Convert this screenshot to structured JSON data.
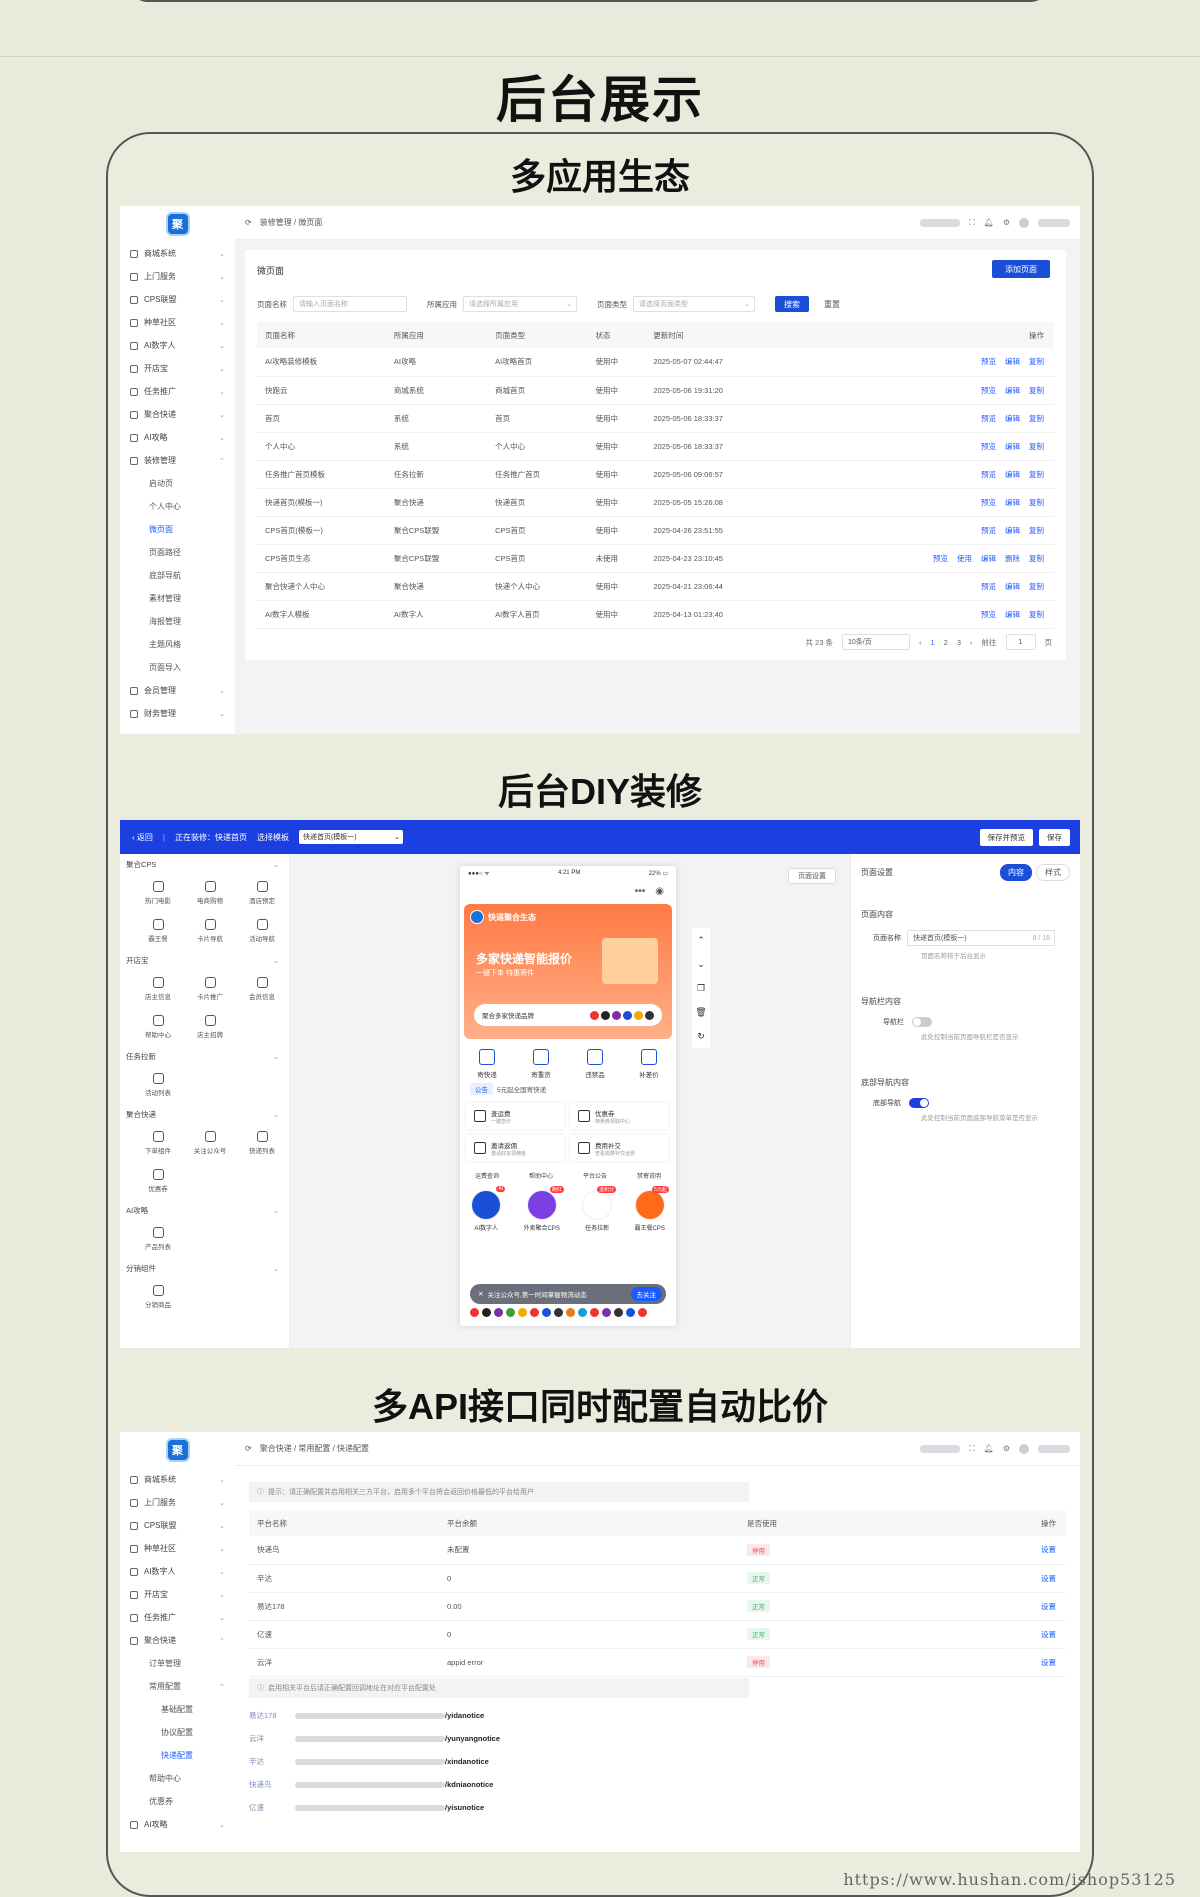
{
  "header_title": "后台展示",
  "sections": {
    "s1": "多应用生态",
    "s2": "后台DIY装修",
    "s3": "多API接口同时配置自动比价"
  },
  "logo_text": "聚",
  "shot1": {
    "breadcrumb": "装修管理 / 微页面",
    "nav": [
      {
        "label": "商城系统",
        "icon": "shop-icon"
      },
      {
        "label": "上门服务",
        "icon": "home-service-icon"
      },
      {
        "label": "CPS联盟",
        "icon": "cps-icon"
      },
      {
        "label": "种草社区",
        "icon": "community-icon"
      },
      {
        "label": "AI数字人",
        "icon": "ai-icon"
      },
      {
        "label": "开店宝",
        "icon": "store-icon"
      },
      {
        "label": "任务推广",
        "icon": "task-icon"
      },
      {
        "label": "聚合快递",
        "icon": "express-icon"
      },
      {
        "label": "AI攻略",
        "icon": "guide-icon"
      },
      {
        "label": "装修管理",
        "icon": "decor-icon"
      }
    ],
    "nav_sub": [
      "启动页",
      "个人中心",
      "微页面",
      "页面路径",
      "底部导航",
      "素材管理",
      "海报管理",
      "主题风格",
      "页面导入"
    ],
    "nav_after": [
      {
        "label": "会员管理",
        "icon": "member-icon"
      },
      {
        "label": "财务管理",
        "icon": "finance-icon"
      }
    ],
    "card_title": "微页面",
    "add_button": "添加页面",
    "filters": {
      "name_label": "页面名称",
      "name_placeholder": "请输入页面名称",
      "app_label": "所属应用",
      "app_placeholder": "请选择所属应用",
      "type_label": "页面类型",
      "type_placeholder": "请选择页面类型",
      "search": "搜索",
      "reset": "重置"
    },
    "columns": [
      "页面名称",
      "所属应用",
      "页面类型",
      "状态",
      "更新时间",
      "操作"
    ],
    "rows": [
      [
        "AI攻略装修模板",
        "AI攻略",
        "AI攻略首页",
        "使用中",
        "2025-05-07 02:44:47"
      ],
      [
        "快跑云",
        "商城系统",
        "商城首页",
        "使用中",
        "2025-05-06 19:31:20"
      ],
      [
        "首页",
        "系统",
        "首页",
        "使用中",
        "2025-05-06 18:33:37"
      ],
      [
        "个人中心",
        "系统",
        "个人中心",
        "使用中",
        "2025-05-06 18:33:37"
      ],
      [
        "任务推广首页模板",
        "任务拉新",
        "任务推广首页",
        "使用中",
        "2025-05-06 09:06:57"
      ],
      [
        "快递首页(模板一)",
        "聚合快递",
        "快递首页",
        "使用中",
        "2025-05-05 15:26:08"
      ],
      [
        "CPS首页(模板一)",
        "聚合CPS联盟",
        "CPS首页",
        "使用中",
        "2025-04-26 23:51:55"
      ],
      [
        "CPS首页生态",
        "聚合CPS联盟",
        "CPS首页",
        "未使用",
        "2025-04-23 23:10:45"
      ],
      [
        "聚合快递个人中心",
        "聚合快递",
        "快递个人中心",
        "使用中",
        "2025-04-21 23:06:44"
      ],
      [
        "AI数字人模板",
        "AI数字人",
        "AI数字人首页",
        "使用中",
        "2025-04-13 01:23:40"
      ]
    ],
    "ops": [
      "预览",
      "编辑",
      "复制"
    ],
    "ops_unused": [
      "预览",
      "使用",
      "编辑",
      "删除",
      "复制"
    ],
    "pager": {
      "total": "共 23 条",
      "size": "10条/页",
      "pages": [
        "1",
        "2",
        "3"
      ],
      "goto": "前往",
      "goto_value": "1",
      "page_unit": "页"
    }
  },
  "shot2": {
    "back": "返回",
    "editing": "正在装修：快递首页",
    "select_label": "选择模板",
    "select_value": "快递首页(模板一)",
    "save_preview": "保存并预览",
    "save": "保存",
    "groups": [
      {
        "title": "聚合CPS",
        "items": [
          "热门电影",
          "电商购物",
          "酒店预定",
          "霸王餐",
          "卡片导航",
          "活动导航"
        ]
      },
      {
        "title": "开店宝",
        "items": [
          "店主信息",
          "卡片推广",
          "会员信息",
          "帮助中心",
          "店主招牌"
        ]
      },
      {
        "title": "任务拉新",
        "items": [
          "活动列表"
        ]
      },
      {
        "title": "聚合快递",
        "items": [
          "下单组件",
          "关注公众号",
          "快递列表",
          "优惠券"
        ]
      },
      {
        "title": "AI攻略",
        "items": [
          "产品列表"
        ]
      },
      {
        "title": "分销组件",
        "items": [
          "分销商品"
        ]
      }
    ],
    "phone": {
      "time": "4:21 PM",
      "battery": "22%",
      "brand": "快递聚合生态",
      "banner_title": "多家快递智能报价",
      "banner_sub": "一键下单 特惠寄件",
      "banner_strip": "聚合多家快递品牌",
      "icons": [
        "寄快递",
        "寄重货",
        "违禁品",
        "补差价"
      ],
      "notice_tag": "公告",
      "notice": "5元起全国寄快递",
      "cards": [
        {
          "t": "查运费",
          "s": "一键查价"
        },
        {
          "t": "优惠券",
          "s": "特惠券领取中心"
        },
        {
          "t": "邀请返佣",
          "s": "邀请好友领佣金"
        },
        {
          "t": "费用补交",
          "s": "查看需要补交运费"
        }
      ],
      "links": [
        "运费查询",
        "帮助中心",
        "平台公告",
        "禁寄说明"
      ],
      "apps": [
        "AI数字人",
        "外卖聚合CPS",
        "任务拉新",
        "霸王餐CPS"
      ],
      "badges": [
        "AI",
        "跑红",
        "送积分",
        "5元起"
      ],
      "follow_text": "关注公众号,第一时间掌握物流动态",
      "follow_btn": "去关注"
    },
    "page_setting_btn": "页面设置",
    "right": {
      "title": "页面设置",
      "tab_content": "内容",
      "tab_style": "样式",
      "sec1": "页面内容",
      "name_label": "页面名称",
      "name_value": "快递首页(模板一)",
      "name_count": "8 / 16",
      "name_hint": "页面名称将于后台显示",
      "sec2": "导航栏内容",
      "nav_label": "导航栏",
      "nav_hint": "此处控制当前页面导航栏是否显示",
      "sec3": "底部导航内容",
      "bottom_label": "底部导航",
      "bottom_hint": "此处控制当前页面底部导航菜单是否显示"
    }
  },
  "shot3": {
    "breadcrumb": "聚合快递 / 常用配置 / 快递配置",
    "nav": [
      {
        "label": "商城系统",
        "icon": "shop-icon"
      },
      {
        "label": "上门服务",
        "icon": "home-service-icon"
      },
      {
        "label": "CPS联盟",
        "icon": "cps-icon"
      },
      {
        "label": "种草社区",
        "icon": "community-icon"
      },
      {
        "label": "AI数字人",
        "icon": "ai-icon"
      },
      {
        "label": "开店宝",
        "icon": "store-icon"
      },
      {
        "label": "任务推广",
        "icon": "task-icon"
      },
      {
        "label": "聚合快递",
        "icon": "express-icon"
      }
    ],
    "sub1": "订单管理",
    "sub2": "常用配置",
    "sub2_items": [
      "基础配置",
      "协议配置",
      "快递配置"
    ],
    "sub_more": [
      "帮助中心",
      "优惠券"
    ],
    "nav_last": {
      "label": "AI攻略",
      "icon": "guide-icon"
    },
    "tip1": "提示：请正确配置并启用相关三方平台，启用多个平台将会返回价格最低的平台给用户",
    "columns": [
      "平台名称",
      "平台余额",
      "是否使用",
      "操作"
    ],
    "rows": [
      {
        "name": "快递鸟",
        "balance": "未配置",
        "status": "停用",
        "ok": false
      },
      {
        "name": "辛达",
        "balance": "0",
        "status": "正常",
        "ok": true
      },
      {
        "name": "易达178",
        "balance": "0.00",
        "status": "正常",
        "ok": true
      },
      {
        "name": "亿速",
        "balance": "0",
        "status": "正常",
        "ok": true
      },
      {
        "name": "云洋",
        "balance": "appid error",
        "status": "停用",
        "ok": false
      }
    ],
    "op": "设置",
    "tip2": "启用相关平台后请正确配置回调地址在对应平台配置处",
    "callbacks": [
      {
        "name": "易达178",
        "url": "/yidanotice"
      },
      {
        "name": "云洋",
        "url": "/yunyangnotice"
      },
      {
        "name": "辛达",
        "url": "/xindanotice"
      },
      {
        "name": "快递鸟",
        "url": "/kdniaonotice"
      },
      {
        "name": "亿速",
        "url": "/yisunotice"
      }
    ]
  },
  "watermark": "https://www.hushan.com/ishop53125"
}
